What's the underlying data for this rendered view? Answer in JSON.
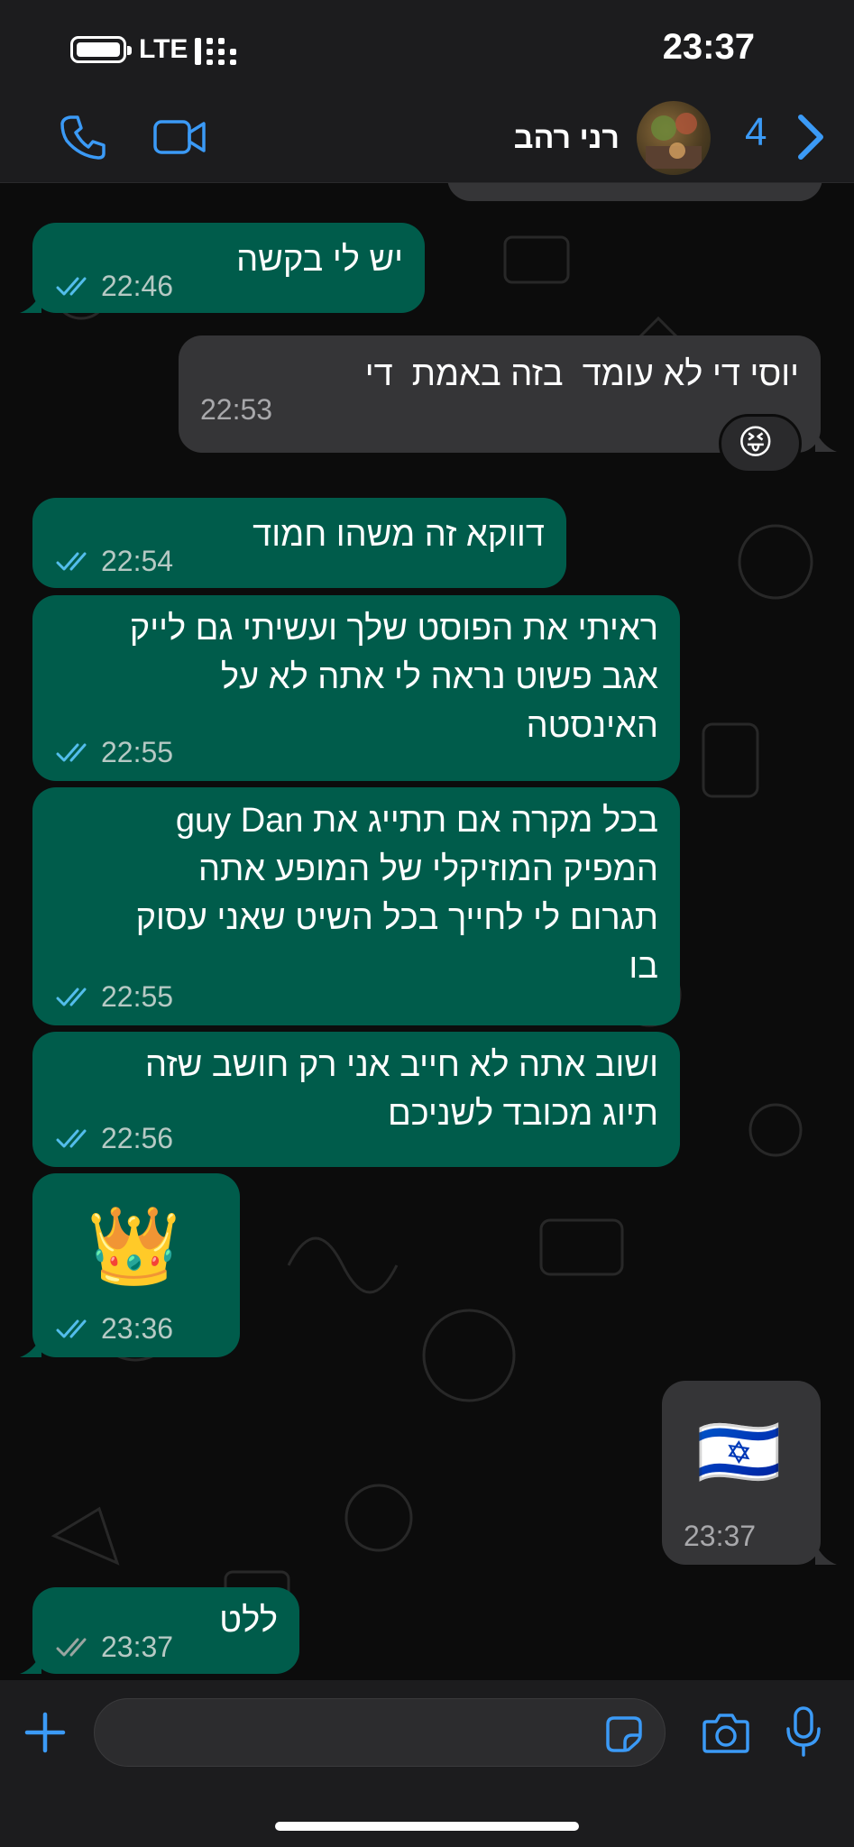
{
  "status_bar": {
    "time": "23:37",
    "network": "LTE"
  },
  "header": {
    "contact_name": "רני רהב",
    "unread_count": "4",
    "icons": [
      "phone-icon",
      "video-icon",
      "avatar",
      "chevron-right-icon"
    ]
  },
  "messages": [
    {
      "text": "יש לי בקשה",
      "time": "22:46",
      "direction": "outgoing",
      "status": "read"
    },
    {
      "text": "יוסי די לא עומד  בזה באמת  די",
      "time": "22:53",
      "direction": "incoming",
      "reaction": "😝"
    },
    {
      "text": "דווקא זה משהו חמוד",
      "time": "22:54",
      "direction": "outgoing",
      "status": "read"
    },
    {
      "text": "ראיתי את הפוסט שלך ועשיתי גם לייק\nאגב פשוט נראה לי אתה לא על\nהאינסטה",
      "time": "22:55",
      "direction": "outgoing",
      "status": "read"
    },
    {
      "text": "בכל מקרה אם תתייג את guy Dan\nהמפיק המוזיקלי של המופע אתה\nתגרום לי לחייך בכל השיט שאני עסוק\nבו",
      "time": "22:55",
      "direction": "outgoing",
      "status": "read"
    },
    {
      "text": "ושוב אתה לא חייב אני רק חושב שזה\nתיוג מכובד לשניכם",
      "time": "22:56",
      "direction": "outgoing",
      "status": "read"
    },
    {
      "text": "👑",
      "time": "23:36",
      "direction": "outgoing",
      "status": "read"
    },
    {
      "text": "🇮🇱",
      "time": "23:37",
      "direction": "incoming"
    },
    {
      "text": "ללט",
      "time": "23:37",
      "direction": "outgoing",
      "status": "delivered"
    }
  ],
  "input_bar": {
    "icons": [
      "plus-icon",
      "sticker-icon",
      "camera-icon",
      "microphone-icon"
    ],
    "message_value": ""
  },
  "colors": {
    "outgoing_bubble": "#005c4b",
    "incoming_bubble": "#353537",
    "accent": "#3b9af6",
    "background": "#0c0c0c"
  }
}
